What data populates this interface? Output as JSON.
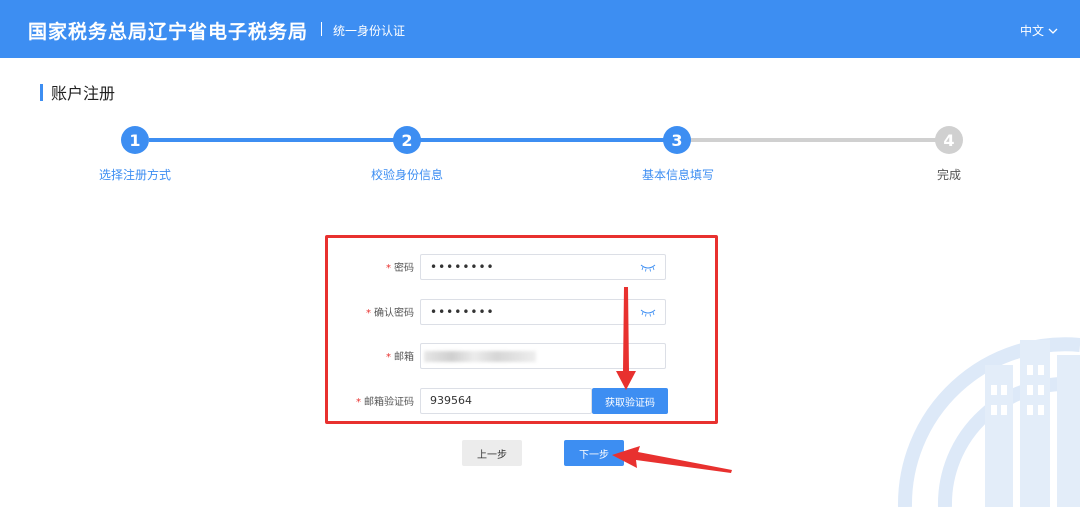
{
  "header": {
    "title": "国家税务总局辽宁省电子税务局",
    "subtitle": "统一身份认证",
    "language": "中文"
  },
  "page_title": "账户注册",
  "steps": [
    {
      "number": "1",
      "label": "选择注册方式",
      "state": "done"
    },
    {
      "number": "2",
      "label": "校验身份信息",
      "state": "done"
    },
    {
      "number": "3",
      "label": "基本信息填写",
      "state": "current"
    },
    {
      "number": "4",
      "label": "完成",
      "state": "todo"
    }
  ],
  "form": {
    "required_mark": "*",
    "password": {
      "label": "密码",
      "value": "••••••••"
    },
    "confirm_password": {
      "label": "确认密码",
      "value": "••••••••"
    },
    "email": {
      "label": "邮箱",
      "value": ""
    },
    "email_code": {
      "label": "邮箱验证码",
      "value": "939564",
      "button": "获取验证码"
    }
  },
  "buttons": {
    "prev": "上一步",
    "next": "下一步"
  },
  "colors": {
    "primary": "#3d8ef2",
    "annotation": "#e8312f",
    "inactive": "#d0d0d0"
  },
  "icons": {
    "language_dropdown": "chevron-down-icon",
    "password_toggle": "eye-closed-icon"
  }
}
